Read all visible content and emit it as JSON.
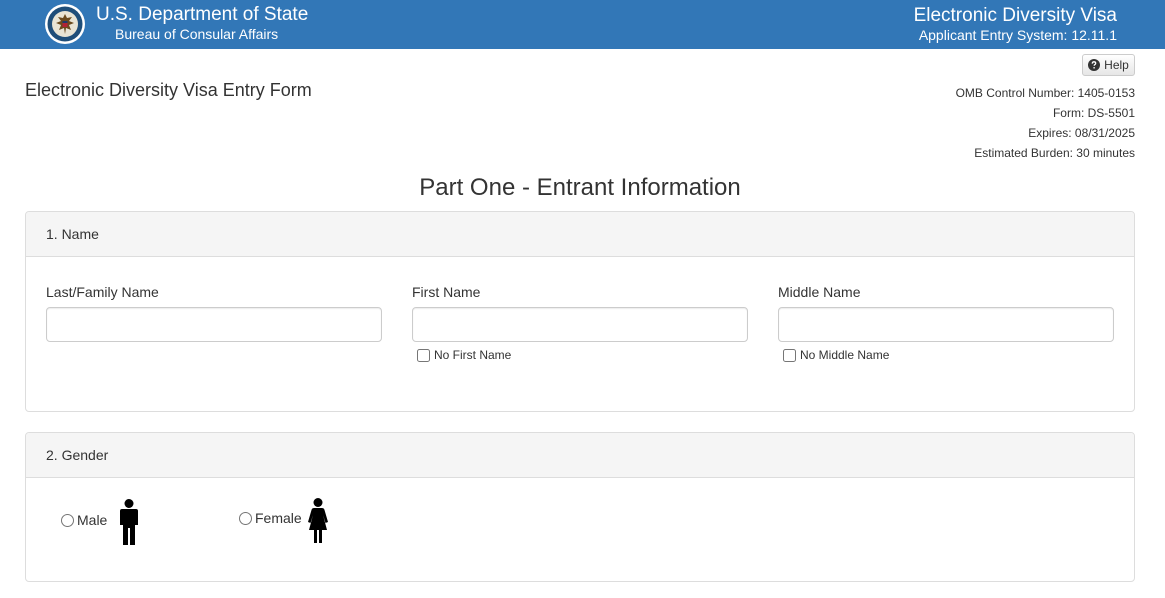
{
  "header": {
    "agency": "U.S. Department of State",
    "bureau": "Bureau of Consular Affairs",
    "system_title": "Electronic Diversity Visa",
    "system_version": "Applicant Entry System: 12.11.1",
    "seal_icon": "state-department-seal",
    "background_color": "#3277b7"
  },
  "help": {
    "label": "Help",
    "icon": "question-circle-icon"
  },
  "form_title": "Electronic Diversity Visa Entry Form",
  "omb": {
    "control_number": "OMB Control Number: 1405-0153",
    "form": "Form: DS-5501",
    "expires": "Expires: 08/31/2025",
    "burden": "Estimated Burden: 30 minutes"
  },
  "part_title": "Part One - Entrant Information",
  "name_section": {
    "heading": "1. Name",
    "last_name": {
      "label": "Last/Family Name",
      "value": ""
    },
    "first_name": {
      "label": "First Name",
      "value": "",
      "checkbox_label": "No First Name",
      "checked": false
    },
    "middle_name": {
      "label": "Middle Name",
      "value": "",
      "checkbox_label": "No Middle Name",
      "checked": false
    }
  },
  "gender_section": {
    "heading": "2. Gender",
    "options": [
      {
        "label": "Male",
        "icon": "male-person-icon",
        "selected": false
      },
      {
        "label": "Female",
        "icon": "female-person-icon",
        "selected": false
      }
    ]
  }
}
